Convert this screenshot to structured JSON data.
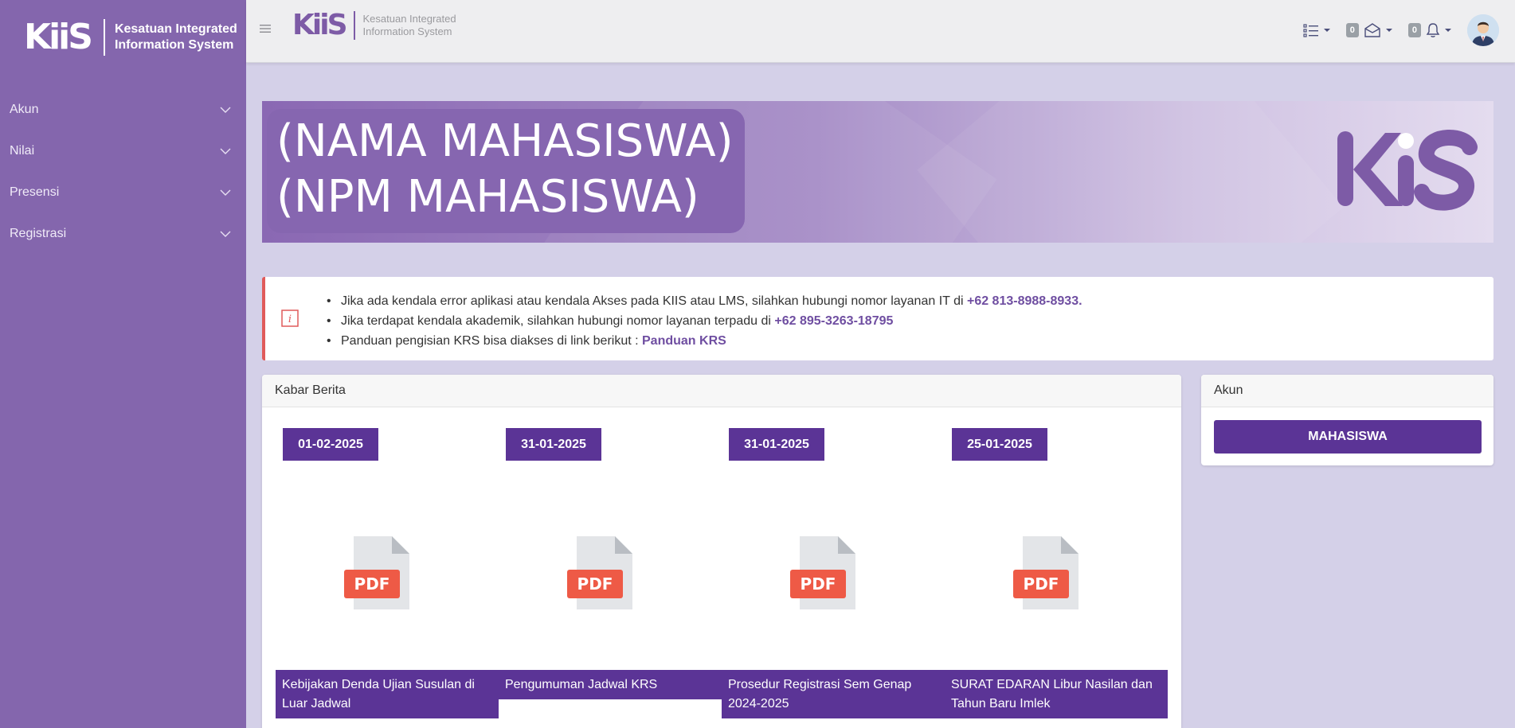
{
  "brand": {
    "logo": "KiiS",
    "line1": "Kesatuan Integrated",
    "line2": "Information System"
  },
  "sidebar": {
    "items": [
      {
        "label": "Akun"
      },
      {
        "label": "Nilai"
      },
      {
        "label": "Presensi"
      },
      {
        "label": "Registrasi"
      }
    ]
  },
  "topbar": {
    "mail_count": "0",
    "notif_count": "0"
  },
  "banner": {
    "name": "(NAMA MAHASISWA)",
    "npm": "(NPM MAHASISWA)",
    "logo": "KiiS"
  },
  "info": {
    "line1_text": "Jika ada kendala error aplikasi atau kendala Akses pada KIIS atau LMS, silahkan hubungi nomor layanan IT di ",
    "line1_phone": "+62 813-8988-8933.",
    "line2_text": "Jika terdapat kendala akademik, silahkan hubungi nomor layanan terpadu di ",
    "line2_phone": "+62 895-3263-18795",
    "line3_text": "Panduan pengisian KRS bisa diakses di link berikut : ",
    "line3_link": "Panduan KRS"
  },
  "news": {
    "title": "Kabar Berita",
    "pdf_label": "PDF",
    "items": [
      {
        "date": "01-02-2025",
        "title": "Kebijakan Denda Ujian Susulan di Luar Jadwal"
      },
      {
        "date": "31-01-2025",
        "title": "Pengumuman Jadwal KRS"
      },
      {
        "date": "31-01-2025",
        "title": "Prosedur Registrasi Sem Genap 2024-2025"
      },
      {
        "date": "25-01-2025",
        "title": "SURAT EDARAN Libur Nasilan dan Tahun Baru Imlek"
      }
    ]
  },
  "akun": {
    "title": "Akun",
    "button": "MAHASISWA"
  },
  "colors": {
    "sidebar": "#8466ad",
    "primary": "#5b3496",
    "accent": "#6f4ea1",
    "alert_border": "#e05a5a"
  }
}
